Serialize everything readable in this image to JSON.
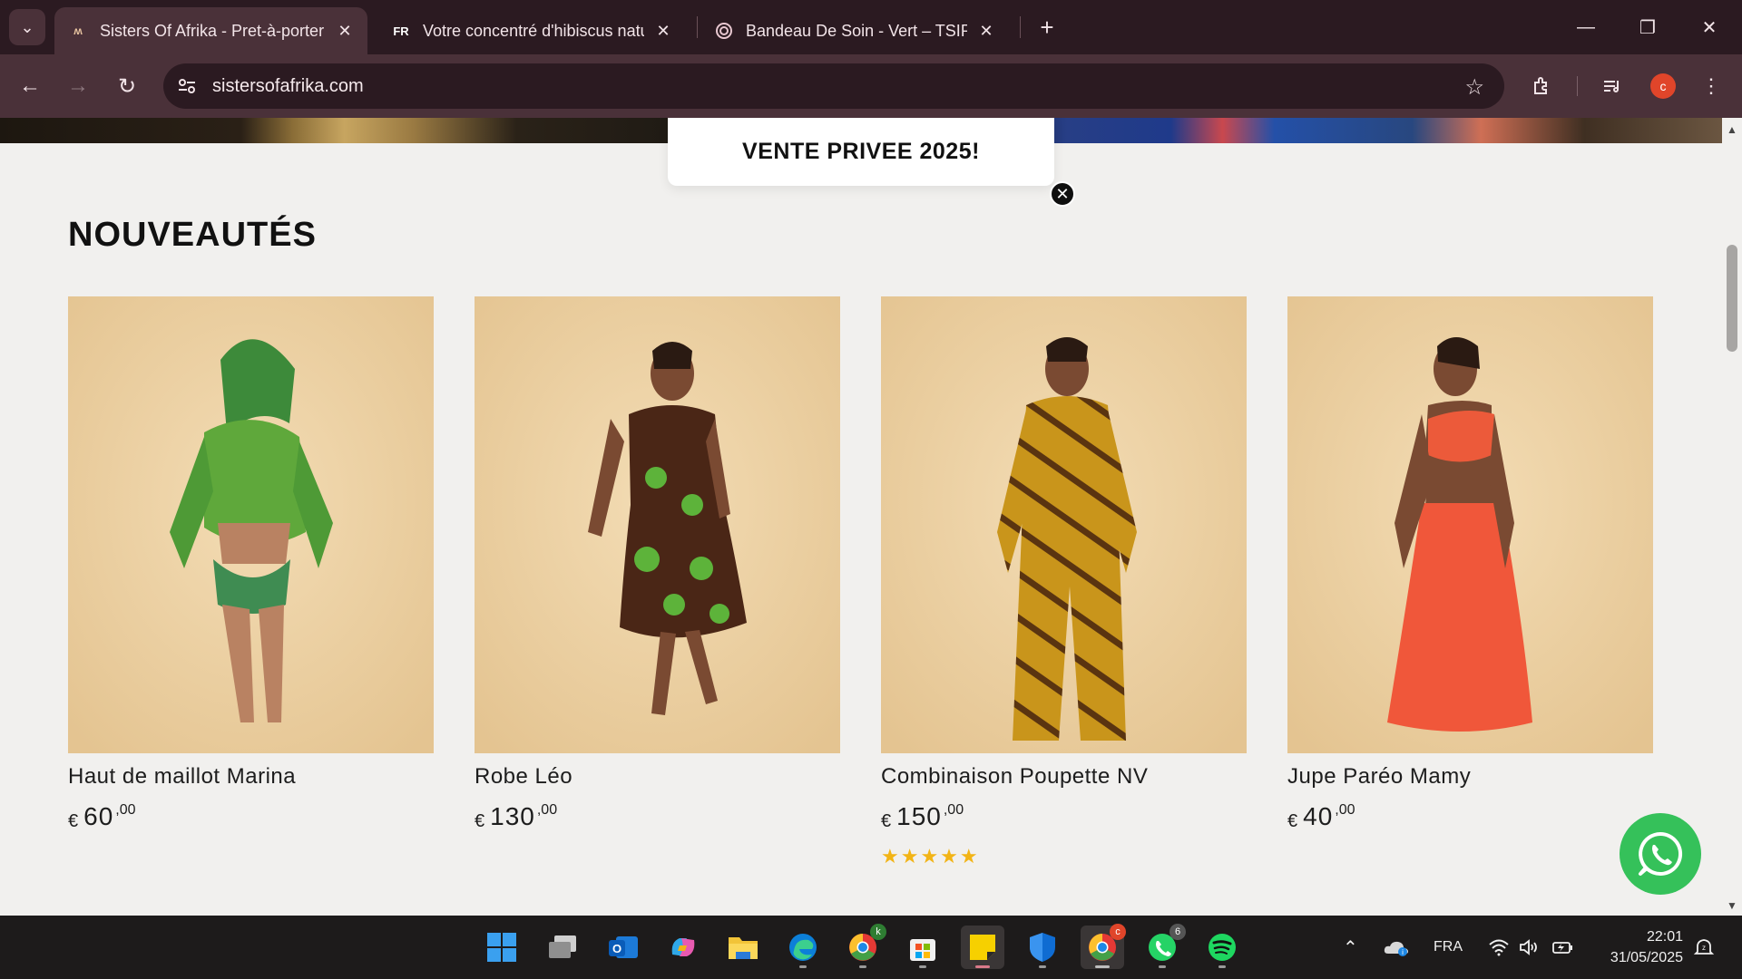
{
  "browser": {
    "tabs": [
      {
        "favicon": "sisters-of-afrika-favicon",
        "title": "Sisters Of Afrika - Pret-à-porter",
        "active": true
      },
      {
        "favicon_text": "FR",
        "title": "Votre concentré d'hibiscus natu",
        "active": false
      },
      {
        "favicon": "tsipie-favicon",
        "title": "Bandeau De Soin - Vert – TSIPIE",
        "active": false
      }
    ],
    "url": "sistersofafrika.com",
    "profile_initial": "c"
  },
  "page": {
    "popup_text": "VENTE PRIVEE 2025!",
    "section_title": "NOUVEAUTÉS",
    "products": [
      {
        "name": "Haut de maillot Marina",
        "currency": "€",
        "price_int": "60",
        "price_dec": ",00",
        "stars": ""
      },
      {
        "name": "Robe Léo",
        "currency": "€",
        "price_int": "130",
        "price_dec": ",00",
        "stars": ""
      },
      {
        "name": "Combinaison Poupette NV",
        "currency": "€",
        "price_int": "150",
        "price_dec": ",00",
        "stars": "★★★★★"
      },
      {
        "name": "Jupe Paréo Mamy",
        "currency": "€",
        "price_int": "40",
        "price_dec": ",00",
        "stars": ""
      }
    ],
    "rating_color": "#f2b416",
    "whatsapp_color": "#35c15a"
  },
  "taskbar": {
    "apps": [
      "windows-start-icon",
      "task-view-icon",
      "outlook-icon",
      "copilot-icon",
      "file-explorer-icon",
      "edge-icon",
      "chrome-profile-k-icon",
      "microsoft-store-icon",
      "sticky-notes-icon",
      "defender-icon",
      "chrome-icon",
      "whatsapp-icon",
      "spotify-icon"
    ],
    "whatsapp_badge": "6",
    "chrome_k_badge": "k",
    "language": "FRA",
    "time": "22:01",
    "date": "31/05/2025"
  },
  "colors": {
    "chrome_dark": "#2b1a21",
    "chrome_mid": "#4a3139",
    "page_bg": "#f1f0ee"
  }
}
